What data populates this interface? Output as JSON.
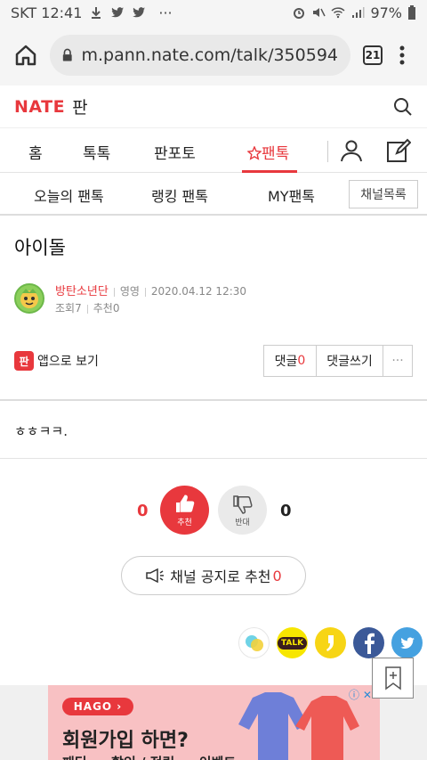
{
  "status_bar": {
    "carrier_time": "SKT 12:41",
    "dots": "···",
    "battery": "97%"
  },
  "browser": {
    "url": "m.pann.nate.com/talk/350594",
    "tab_count": "21"
  },
  "site": {
    "logo": "NATE",
    "logo_sub": "판"
  },
  "main_nav": {
    "items": [
      "홈",
      "톡톡",
      "판포토",
      "팬톡"
    ]
  },
  "sub_nav": {
    "items": [
      "오늘의 팬톡",
      "랭킹 팬톡",
      "MY팬톡"
    ],
    "channel_list": "채널목록"
  },
  "post": {
    "title": "아이돌",
    "author": "방탄소년단",
    "language": "영영",
    "date": "2020.04.12 12:30",
    "views_label": "조회",
    "views": "7",
    "rec_label": "추천",
    "rec": "0",
    "content": "ㅎㅎㅋㅋ."
  },
  "actions": {
    "app_icon": "판",
    "app_view": "앱으로 보기",
    "comments_label": "댓글",
    "comments": "0",
    "write_comment": "댓글쓰기",
    "more": "···"
  },
  "vote": {
    "up_count": "0",
    "up_label": "추천",
    "down_count": "0",
    "down_label": "반대"
  },
  "channel_notice": {
    "label": "채널 공지로 추천",
    "count": "0"
  },
  "share": {
    "talk": "TALK"
  },
  "ad": {
    "brand": "HAGO ›",
    "headline": "회원가입 하면?",
    "sub": "패딩 ... 할인 / 적립 ... 이벤트 ..."
  },
  "colors": {
    "accent": "#e8383d"
  }
}
